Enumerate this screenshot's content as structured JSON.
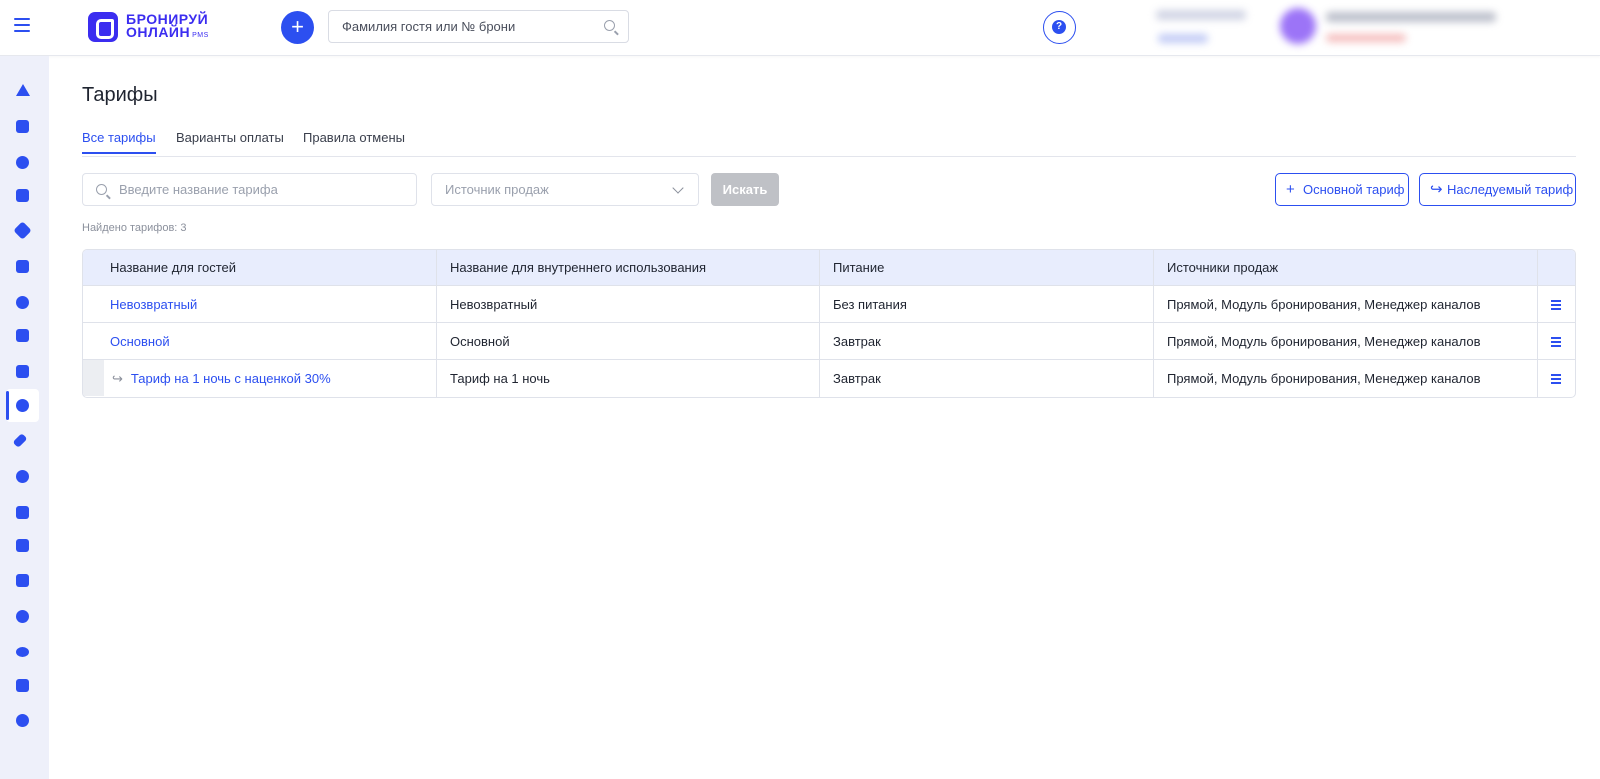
{
  "header": {
    "logo_line1": "БРОНИРУЙ",
    "logo_line2": "ОНЛАЙН",
    "logo_suffix": "PMS",
    "add_label": "+",
    "search_placeholder": "Фамилия гостя или № брони",
    "help_label": "?"
  },
  "sidebar": {
    "items": [
      {
        "icon": "bell-icon"
      },
      {
        "icon": "calendar-icon"
      },
      {
        "icon": "guest-icon"
      },
      {
        "icon": "percent-icon"
      },
      {
        "icon": "tag-icon"
      },
      {
        "icon": "document-icon"
      },
      {
        "icon": "coins-icon"
      },
      {
        "icon": "chart-icon"
      },
      {
        "icon": "checkbox-icon"
      },
      {
        "icon": "rates-icon",
        "active": true
      },
      {
        "icon": "broom-icon"
      },
      {
        "icon": "gear-icon"
      },
      {
        "icon": "box-icon"
      },
      {
        "icon": "wallet-icon"
      },
      {
        "icon": "calculator-icon"
      },
      {
        "icon": "shield-icon"
      },
      {
        "icon": "cloud-icon"
      },
      {
        "icon": "megaphone-icon"
      },
      {
        "icon": "user-icon"
      }
    ]
  },
  "page": {
    "title": "Тарифы",
    "tabs": [
      {
        "label": "Все тарифы",
        "active": true
      },
      {
        "label": "Варианты оплаты",
        "active": false
      },
      {
        "label": "Правила отмены",
        "active": false
      }
    ],
    "filter": {
      "name_placeholder": "Введите название тарифа",
      "source_placeholder": "Источник продаж",
      "search_label": "Искать"
    },
    "actions": {
      "main_tariff": "Основной тариф",
      "derived_tariff": "Наследуемый тариф"
    },
    "found_text": "Найдено тарифов: 3"
  },
  "table": {
    "columns": [
      "Название для гостей",
      "Название для внутреннего использования",
      "Питание",
      "Источники продаж"
    ],
    "rows": [
      {
        "guest_name": "Невозвратный",
        "internal_name": "Невозвратный",
        "meal": "Без питания",
        "sources": "Прямой, Модуль бронирования, Менеджер каналов",
        "child": false
      },
      {
        "guest_name": "Основной",
        "internal_name": "Основной",
        "meal": "Завтрак",
        "sources": "Прямой, Модуль бронирования, Менеджер каналов",
        "child": false
      },
      {
        "guest_name": "Тариф на 1 ночь с наценкой 30%",
        "internal_name": "Тариф на 1 ночь",
        "meal": "Завтрак",
        "sources": "Прямой, Модуль бронирования, Менеджер каналов",
        "child": true
      }
    ]
  },
  "colors": {
    "accent": "#2c4ff0",
    "brand": "#3b2df0",
    "header_row": "#e8edfd",
    "sidebar": "#eef0fa"
  }
}
